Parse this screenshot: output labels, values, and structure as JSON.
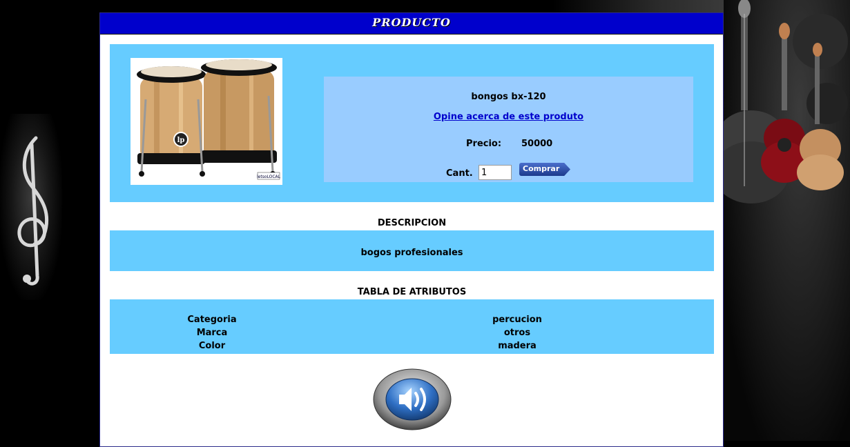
{
  "header": {
    "title": "PRODUCTO"
  },
  "product": {
    "name": "bongos bx-120",
    "opine_link": "Opine acerca de este produto",
    "price_label": "Precio:",
    "price_value": "50000",
    "qty_label": "Cant.",
    "qty_value": "1",
    "buy_label": "Comprar",
    "image_stamp": "letsoLOCAL",
    "logo_text": "lp"
  },
  "description": {
    "title": "DESCRIPCION",
    "text": "bogos profesionales"
  },
  "attributes": {
    "title": "TABLA DE ATRIBUTOS",
    "rows": [
      {
        "key": "Categoria",
        "value": "percucion"
      },
      {
        "key": "Marca",
        "value": "otros"
      },
      {
        "key": "Color",
        "value": "madera"
      }
    ]
  },
  "icons": {
    "sound": "speaker-icon",
    "clef": "treble-clef-icon",
    "guitars": "guitars-decoration"
  },
  "colors": {
    "header_bg": "#0000cc",
    "box_bg": "#66ccff",
    "info_bg": "#99ccff"
  }
}
